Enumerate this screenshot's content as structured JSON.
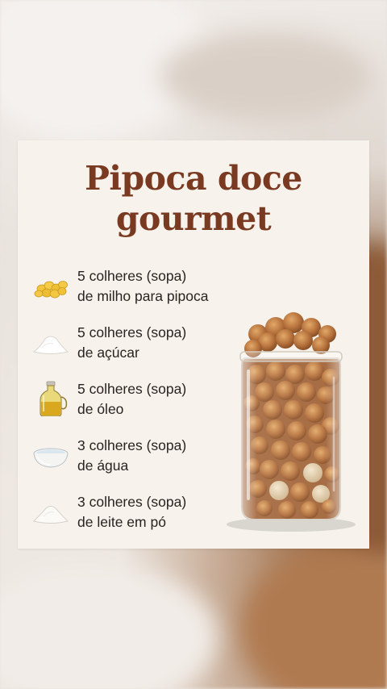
{
  "recipe": {
    "title_line1": "Pipoca doce",
    "title_line2": "gourmet",
    "ingredients": [
      {
        "line1": "5 colheres (sopa)",
        "line2": "de milho para pipoca",
        "icon": "corn-kernels-icon"
      },
      {
        "line1": "5 colheres (sopa)",
        "line2": "de açúcar",
        "icon": "sugar-pile-icon"
      },
      {
        "line1": "5 colheres (sopa)",
        "line2": "de óleo",
        "icon": "oil-bottle-icon"
      },
      {
        "line1": "3 colheres (sopa)",
        "line2": "de água",
        "icon": "water-bowl-icon"
      },
      {
        "line1": "3 colheres (sopa)",
        "line2": "de leite em pó",
        "icon": "milk-powder-pile-icon"
      }
    ]
  },
  "colors": {
    "title": "#7a3a22",
    "text": "#2a2320",
    "card_background": "#f7f3ec",
    "caramel": "#b8743e"
  }
}
